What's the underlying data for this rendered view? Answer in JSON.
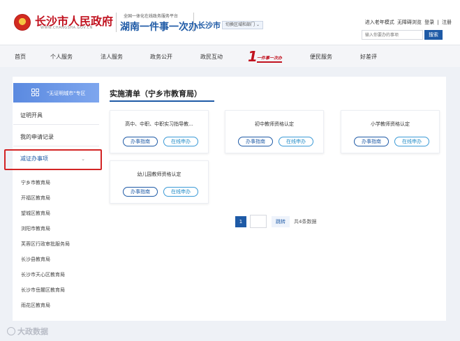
{
  "header": {
    "gov_name": "长沙市人民政府",
    "gov_domain": "WWW.CHANGSHA.GOV.CN",
    "platform_top": "全国一体化在线政务服务平台",
    "platform_main": "湖南一件事一次办",
    "city": "长沙市",
    "region_switch": "切换区域和部门",
    "top_links": {
      "elder_mode": "进入老年模式",
      "accessible": "无障碍浏览",
      "login": "登录",
      "separator": "|",
      "register": "注册"
    },
    "search": {
      "placeholder": "输入你要办的事项",
      "button": "搜索"
    }
  },
  "nav": {
    "items": [
      "首页",
      "个人服务",
      "法人服务",
      "政务公开",
      "政民互动",
      "便民服务",
      "好差评"
    ],
    "logo_one": "1",
    "logo_text": "一件事一次办"
  },
  "sidebar": {
    "header": "\"无证明城市\"专区",
    "menu": [
      "证明开具",
      "我的申请记录",
      "减证办事项"
    ],
    "sub_items": [
      "宁乡市教育局",
      "开福区教育局",
      "望城区教育局",
      "浏阳市教育局",
      "芙蓉区行政审批服务局",
      "长沙县教育局",
      "长沙市天心区教育局",
      "长沙市岳麓区教育局",
      "雨花区教育局"
    ]
  },
  "content": {
    "title": "实施清单（宁乡市教育局）",
    "cards": [
      {
        "name": "高中、中职、中职实习指导教..."
      },
      {
        "name": "初中教师资格认定"
      },
      {
        "name": "小学教师资格认定"
      },
      {
        "name": "幼儿园教师资格认定"
      }
    ],
    "btn_guide": "办事指南",
    "btn_online": "在线申办"
  },
  "pagination": {
    "current": "1",
    "jump": "跳转",
    "total": "共4条数据"
  },
  "watermark": "大政数据"
}
